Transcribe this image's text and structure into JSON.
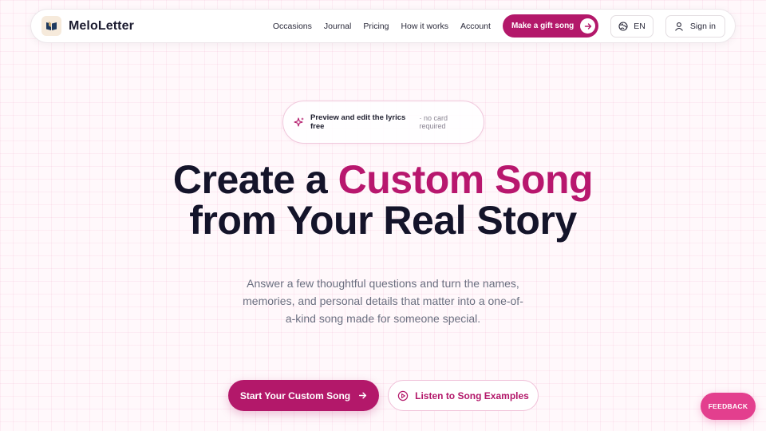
{
  "brand": {
    "name": "MeloLetter",
    "accent": "#b3186a",
    "logo_icon": "book-icon"
  },
  "nav": {
    "links": [
      "Occasions",
      "Journal",
      "Pricing",
      "How it works",
      "Account"
    ],
    "gift_label": "Make a gift song",
    "lang_label": "EN",
    "signin_label": "Sign in"
  },
  "badge": {
    "strong": "Preview and edit the lyrics free",
    "muted": "· no card required",
    "icon": "sparkle-icon"
  },
  "hero": {
    "line1_plain": "Create a ",
    "line1_accent": "Custom Song",
    "line2": "from Your Real Story",
    "subtext": "Answer a few thoughtful questions and turn the names, memories, and personal details that matter into a one-of-a-kind song made for someone special."
  },
  "cta": {
    "primary": "Start Your Custom Song",
    "secondary": "Listen to Song Examples"
  },
  "feedback_label": "FEEDBACK"
}
